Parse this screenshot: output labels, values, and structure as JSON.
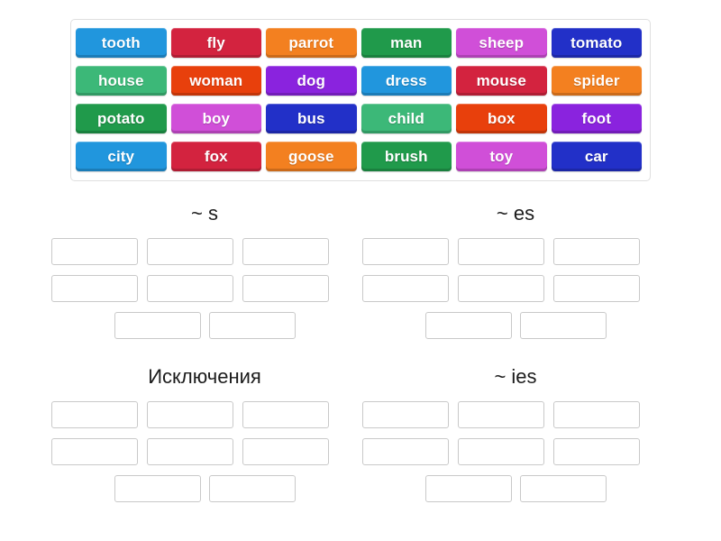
{
  "activity": {
    "type": "group-sort",
    "background_color": "#ffffff"
  },
  "word_bank": {
    "rows": [
      [
        {
          "label": "tooth",
          "color": "#2196dd"
        },
        {
          "label": "fly",
          "color": "#d3233f"
        },
        {
          "label": "parrot",
          "color": "#f38020"
        },
        {
          "label": "man",
          "color": "#209a4b"
        },
        {
          "label": "sheep",
          "color": "#d04fd8"
        },
        {
          "label": "tomato",
          "color": "#2230c8"
        }
      ],
      [
        {
          "label": "house",
          "color": "#3cb878"
        },
        {
          "label": "woman",
          "color": "#e8400c"
        },
        {
          "label": "dog",
          "color": "#8a23de"
        },
        {
          "label": "dress",
          "color": "#2196dd"
        },
        {
          "label": "mouse",
          "color": "#d3233f"
        },
        {
          "label": "spider",
          "color": "#f38020"
        }
      ],
      [
        {
          "label": "potato",
          "color": "#209a4b"
        },
        {
          "label": "boy",
          "color": "#d04fd8"
        },
        {
          "label": "bus",
          "color": "#2230c8"
        },
        {
          "label": "child",
          "color": "#3cb878"
        },
        {
          "label": "box",
          "color": "#e8400c"
        },
        {
          "label": "foot",
          "color": "#8a23de"
        }
      ],
      [
        {
          "label": "city",
          "color": "#2196dd"
        },
        {
          "label": "fox",
          "color": "#d3233f"
        },
        {
          "label": "goose",
          "color": "#f38020"
        },
        {
          "label": "brush",
          "color": "#209a4b"
        },
        {
          "label": "toy",
          "color": "#d04fd8"
        },
        {
          "label": "car",
          "color": "#2230c8"
        }
      ]
    ]
  },
  "groups": [
    {
      "title": "~ s",
      "slot_rows": [
        3,
        3,
        2
      ],
      "slots": [
        "",
        "",
        "",
        "",
        "",
        "",
        "",
        ""
      ]
    },
    {
      "title": "~ es",
      "slot_rows": [
        3,
        3,
        2
      ],
      "slots": [
        "",
        "",
        "",
        "",
        "",
        "",
        "",
        ""
      ]
    },
    {
      "title": "Исключения",
      "slot_rows": [
        3,
        3,
        2
      ],
      "slots": [
        "",
        "",
        "",
        "",
        "",
        "",
        "",
        ""
      ]
    },
    {
      "title": "~ ies",
      "slot_rows": [
        3,
        3,
        2
      ],
      "slots": [
        "",
        "",
        "",
        "",
        "",
        "",
        "",
        ""
      ]
    }
  ]
}
